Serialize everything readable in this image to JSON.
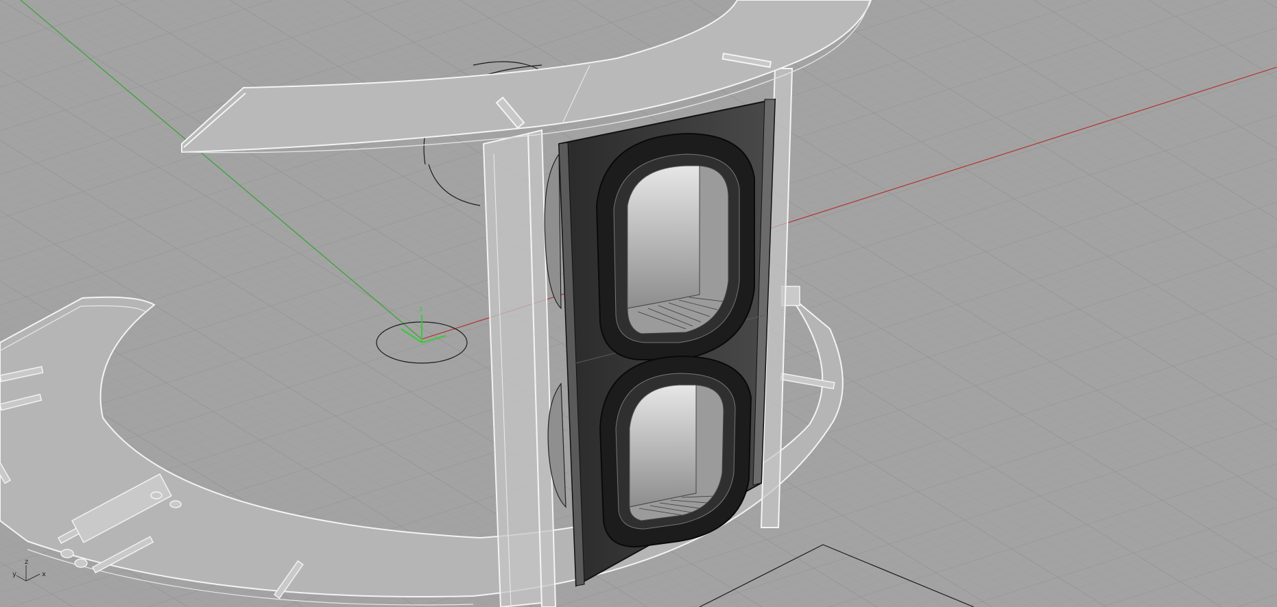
{
  "viewport": {
    "background": "#a3a3a3",
    "grid_minor_color": "#9a9a9a",
    "grid_major_color": "#8e8e8e",
    "x_axis_color": "#b33a3a",
    "y_axis_color": "#3aa33a",
    "model_edge_color": "#f4f4f4",
    "model_fill_color": "#b9b9b9",
    "panel_color": "#3a3a3a"
  },
  "origin_marker": {
    "z_label": "z"
  },
  "axis_widget": {
    "icon": "world-axes-icon",
    "y_label": "y",
    "z_label": "z",
    "x_label": "x"
  }
}
